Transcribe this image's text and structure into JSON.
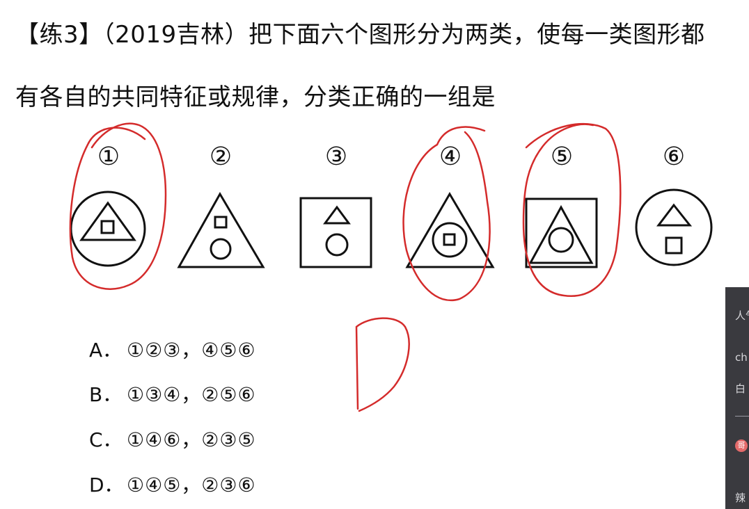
{
  "question": {
    "line1": "【练3】（2019吉林）把下面六个图形分为两类，使每一类图形都",
    "line2": "有各自的共同特征或规律，分类正确的一组是"
  },
  "figures": {
    "labels": [
      "①",
      "②",
      "③",
      "④",
      "⑤",
      "⑥"
    ],
    "shapes": [
      "circle containing triangle containing square",
      "triangle containing square and circle",
      "square containing triangle and circle",
      "triangle containing circle containing square",
      "square containing triangle containing circle",
      "circle containing triangle and square"
    ]
  },
  "options": [
    {
      "letter": "A．",
      "text": "①②③，④⑤⑥"
    },
    {
      "letter": "B．",
      "text": "①③④，②⑤⑥"
    },
    {
      "letter": "C．",
      "text": "①④⑥，②③⑤"
    },
    {
      "letter": "D．",
      "text": "①④⑤，②③⑥"
    }
  ],
  "annotation": {
    "handwritten_answer": "D",
    "ink_color": "#d42b2b",
    "circled_figures": [
      "①",
      "④",
      "⑤"
    ]
  },
  "side_panel": {
    "items": [
      "人气",
      "ch",
      "白",
      "辣"
    ],
    "badge": "哥"
  }
}
